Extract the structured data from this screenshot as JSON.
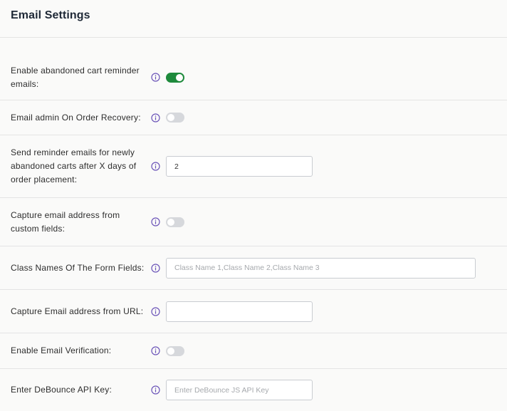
{
  "header": {
    "title": "Email Settings"
  },
  "rows": [
    {
      "label": "Enable abandoned cart reminder emails:",
      "type": "toggle",
      "checked": true
    },
    {
      "label": "Email admin On Order Recovery:",
      "type": "toggle",
      "checked": false
    },
    {
      "label": "Send reminder emails for newly abandoned carts after X days of order placement:",
      "type": "input",
      "value": "2",
      "placeholder": ""
    },
    {
      "label": "Capture email address from custom fields:",
      "type": "toggle",
      "checked": false
    },
    {
      "label": "Class Names Of The Form Fields:",
      "type": "input",
      "value": "",
      "placeholder": "Class Name 1,Class Name 2,Class Name 3"
    },
    {
      "label": "Capture Email address from URL:",
      "type": "input",
      "value": "",
      "placeholder": ""
    },
    {
      "label": "Enable Email Verification:",
      "type": "toggle",
      "checked": false
    },
    {
      "label": "Enter DeBounce API Key:",
      "type": "input",
      "value": "",
      "placeholder": "Enter DeBounce JS API Key"
    }
  ],
  "colors": {
    "toggle_on": "#1e8a3c",
    "toggle_off": "#d6d8dc",
    "info_icon": "#6b54b8"
  }
}
